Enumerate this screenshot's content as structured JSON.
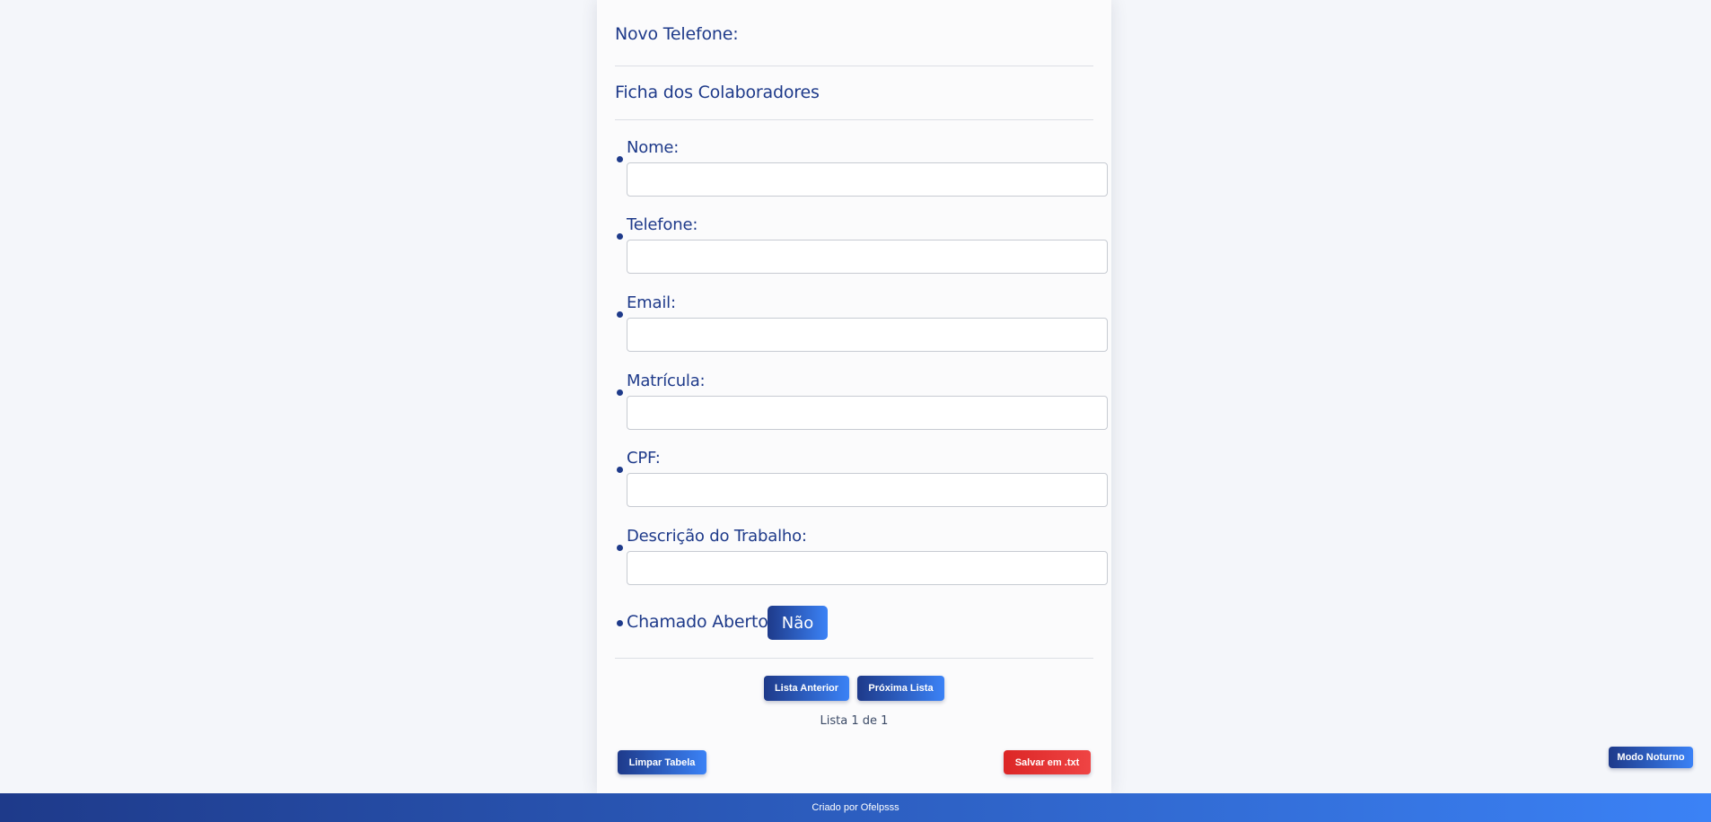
{
  "header": {
    "new_phone_title": "Novo Telefone:",
    "roster_title": "Ficha dos Colaboradores"
  },
  "form": {
    "fields": [
      {
        "label": "Nome:",
        "value": ""
      },
      {
        "label": "Telefone:",
        "value": ""
      },
      {
        "label": "Email:",
        "value": ""
      },
      {
        "label": "Matrícula:",
        "value": ""
      },
      {
        "label": "CPF:",
        "value": ""
      },
      {
        "label": "Descrição do Trabalho:",
        "value": ""
      }
    ],
    "ticket_open_label": "Chamado Aberto?:",
    "ticket_open_value": "Não"
  },
  "pagination": {
    "prev_label": "Lista Anterior",
    "next_label": "Próxima Lista",
    "indicator": "Lista 1 de 1"
  },
  "actions": {
    "clear_label": "Limpar Tabela",
    "save_label": "Salvar em .txt",
    "dark_mode_label": "Modo Noturno"
  },
  "footer": {
    "credit": "Criado por Ofelpsss"
  },
  "colors": {
    "primary_gradient_start": "#1e3a8a",
    "primary_gradient_end": "#3b82f6",
    "danger": "#dc2626",
    "page_background": "#f4f6fa"
  }
}
